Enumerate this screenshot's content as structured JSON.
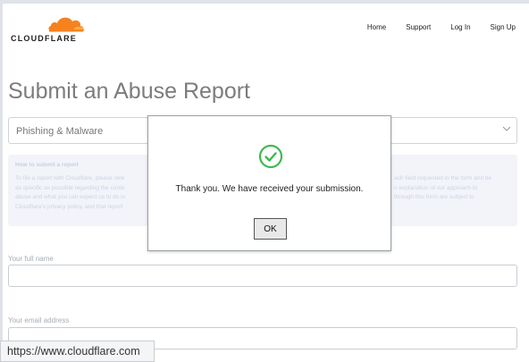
{
  "brand": {
    "name": "CLOUDFLARE",
    "cloud_color": "#f6821f"
  },
  "nav": [
    "Home",
    "Support",
    "Log In",
    "Sign Up"
  ],
  "page_title": "Submit an Abuse Report",
  "report_type": {
    "selected": "Phishing & Malware"
  },
  "info_box": {
    "heading": "How to submit a report",
    "lines": [
      {
        "left": "To file a report with Cloudflare, please sele",
        "right": "ach field requested in the form and be"
      },
      {
        "left": "as specific as possible regarding the conte",
        "right": "n explanation of our approach to"
      },
      {
        "left": "abuse and what you can expect us to do in",
        "right": "through this form are subject to"
      },
      {
        "left": "Cloudflare's privacy policy, and that report",
        "right": ""
      }
    ]
  },
  "form": {
    "full_name_label": "Your full name",
    "full_name_value": "",
    "email_label": "Your email address",
    "email_value": ""
  },
  "modal": {
    "message": "Thank you. We have received your submission.",
    "ok_label": "OK",
    "icon": "check-circle-icon",
    "icon_color": "#3fb950"
  },
  "status_bar": {
    "url": "https://www.cloudflare.com"
  }
}
